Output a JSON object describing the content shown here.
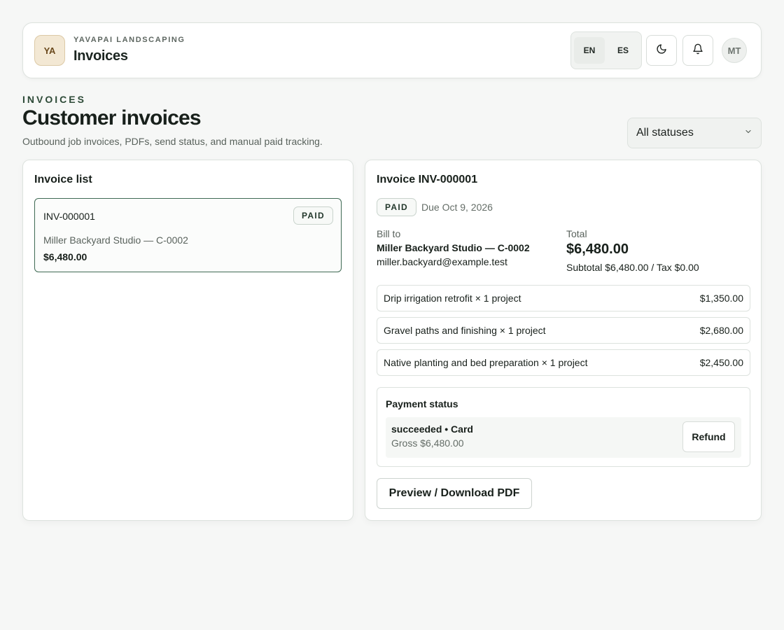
{
  "header": {
    "brand_initials": "YA",
    "brand_name": "YAVAPAI LANDSCAPING",
    "page_name": "Invoices",
    "languages": [
      "EN",
      "ES"
    ],
    "selected_language": "EN",
    "user_initials": "MT",
    "icons": [
      "moon-icon",
      "bell-icon"
    ]
  },
  "page": {
    "eyebrow": "INVOICES",
    "title": "Customer invoices",
    "subtitle": "Outbound job invoices, PDFs, send status, and manual paid tracking.",
    "status_filter": "All statuses"
  },
  "list": {
    "title": "Invoice list",
    "items": [
      {
        "number": "INV-000001",
        "status": "PAID",
        "customer": "Miller Backyard Studio — C-0002",
        "amount": "$6,480.00"
      }
    ]
  },
  "detail": {
    "title": "Invoice INV-000001",
    "status": "PAID",
    "due": "Due Oct 9, 2026",
    "bill_to_label": "Bill to",
    "bill_to_name": "Miller Backyard Studio — C-0002",
    "bill_to_email": "miller.backyard@example.test",
    "total_label": "Total",
    "total": "$6,480.00",
    "subtotal_line": "Subtotal $6,480.00 / Tax $0.00",
    "line_items": [
      {
        "description": "Drip irrigation retrofit × 1 project",
        "amount": "$1,350.00"
      },
      {
        "description": "Gravel paths and finishing × 1 project",
        "amount": "$2,680.00"
      },
      {
        "description": "Native planting and bed preparation × 1 project",
        "amount": "$2,450.00"
      }
    ],
    "payment": {
      "title": "Payment status",
      "method_line": "succeeded • Card",
      "gross_line": "Gross $6,480.00",
      "refund_label": "Refund"
    },
    "pdf_button": "Preview / Download PDF"
  },
  "colors": {
    "accent": "#3f6a54",
    "background": "#f6f7f6",
    "brand_tile": "#f3e8d4"
  }
}
